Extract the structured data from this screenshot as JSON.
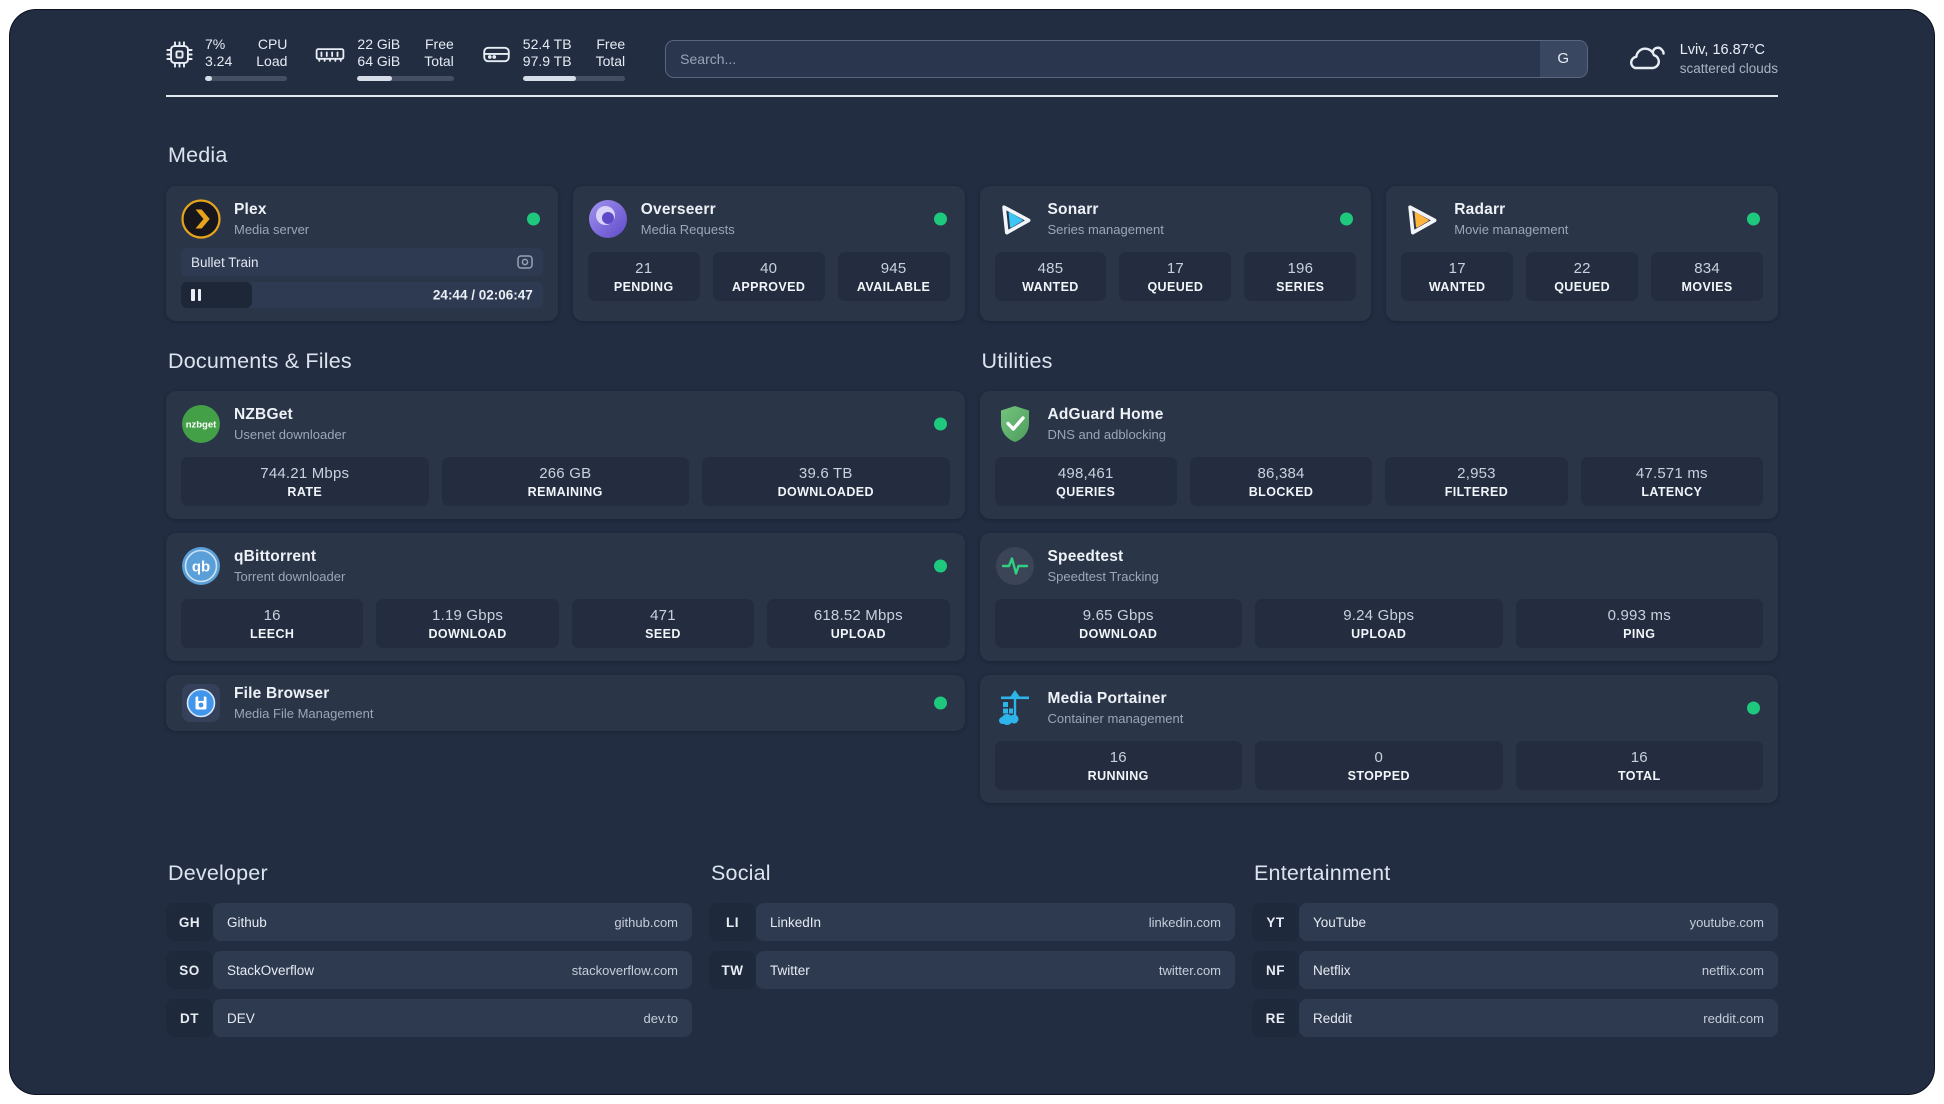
{
  "colors": {
    "status_online": "#1EC97E",
    "accent_plex": "#E6A31C",
    "accent_sonarr": "#3CC5F5",
    "accent_radarr": "#FFB53D",
    "accent_portainer": "#2DB4E9"
  },
  "header": {
    "metrics": [
      {
        "icon": "cpu-icon",
        "line1_value": "7%",
        "line2_value": "3.24",
        "line1_label": "CPU",
        "line2_label": "Load",
        "progress_pct": 8
      },
      {
        "icon": "memory-icon",
        "line1_value": "22 GiB",
        "line2_value": "64 GiB",
        "line1_label": "Free",
        "line2_label": "Total",
        "progress_pct": 36
      },
      {
        "icon": "disk-icon",
        "line1_value": "52.4 TB",
        "line2_value": "97.9 TB",
        "line1_label": "Free",
        "line2_label": "Total",
        "progress_pct": 52
      }
    ],
    "search": {
      "placeholder": "Search...",
      "engine_button": "G"
    },
    "weather": {
      "location": "Lviv, 16.87°C",
      "condition": "scattered clouds"
    }
  },
  "sections": {
    "media": {
      "title": "Media",
      "apps": [
        {
          "name": "Plex",
          "subtitle": "Media server",
          "icon": "plex-icon",
          "online": true,
          "now_playing": {
            "title": "Bullet Train",
            "time": "24:44 / 02:06:47",
            "progress_pct": 19.5
          }
        },
        {
          "name": "Overseerr",
          "subtitle": "Media Requests",
          "icon": "overseerr-icon",
          "online": true,
          "stats": [
            {
              "value": "21",
              "label": "PENDING"
            },
            {
              "value": "40",
              "label": "APPROVED"
            },
            {
              "value": "945",
              "label": "AVAILABLE"
            }
          ]
        },
        {
          "name": "Sonarr",
          "subtitle": "Series management",
          "icon": "sonarr-icon",
          "online": true,
          "stats": [
            {
              "value": "485",
              "label": "WANTED"
            },
            {
              "value": "17",
              "label": "QUEUED"
            },
            {
              "value": "196",
              "label": "SERIES"
            }
          ]
        },
        {
          "name": "Radarr",
          "subtitle": "Movie management",
          "icon": "radarr-icon",
          "online": true,
          "stats": [
            {
              "value": "17",
              "label": "WANTED"
            },
            {
              "value": "22",
              "label": "QUEUED"
            },
            {
              "value": "834",
              "label": "MOVIES"
            }
          ]
        }
      ]
    },
    "documents": {
      "title": "Documents & Files",
      "apps": [
        {
          "name": "NZBGet",
          "subtitle": "Usenet downloader",
          "icon": "nzbget-icon",
          "online": true,
          "stats": [
            {
              "value": "744.21 Mbps",
              "label": "RATE"
            },
            {
              "value": "266 GB",
              "label": "REMAINING"
            },
            {
              "value": "39.6 TB",
              "label": "DOWNLOADED"
            }
          ]
        },
        {
          "name": "qBittorrent",
          "subtitle": "Torrent downloader",
          "icon": "qbittorrent-icon",
          "online": true,
          "stats": [
            {
              "value": "16",
              "label": "LEECH"
            },
            {
              "value": "1.19 Gbps",
              "label": "DOWNLOAD"
            },
            {
              "value": "471",
              "label": "SEED"
            },
            {
              "value": "618.52 Mbps",
              "label": "UPLOAD"
            }
          ]
        },
        {
          "name": "File Browser",
          "subtitle": "Media File Management",
          "icon": "filebrowser-icon",
          "online": true
        }
      ]
    },
    "utilities": {
      "title": "Utilities",
      "apps": [
        {
          "name": "AdGuard Home",
          "subtitle": "DNS and adblocking",
          "icon": "adguard-icon",
          "online": false,
          "stats": [
            {
              "value": "498,461",
              "label": "QUERIES"
            },
            {
              "value": "86,384",
              "label": "BLOCKED"
            },
            {
              "value": "2,953",
              "label": "FILTERED"
            },
            {
              "value": "47.571 ms",
              "label": "LATENCY"
            }
          ]
        },
        {
          "name": "Speedtest",
          "subtitle": "Speedtest Tracking",
          "icon": "speedtest-icon",
          "online": false,
          "stats": [
            {
              "value": "9.65 Gbps",
              "label": "DOWNLOAD"
            },
            {
              "value": "9.24 Gbps",
              "label": "UPLOAD"
            },
            {
              "value": "0.993 ms",
              "label": "PING"
            }
          ]
        },
        {
          "name": "Media Portainer",
          "subtitle": "Container management",
          "icon": "portainer-icon",
          "online": true,
          "stats": [
            {
              "value": "16",
              "label": "RUNNING"
            },
            {
              "value": "0",
              "label": "STOPPED"
            },
            {
              "value": "16",
              "label": "TOTAL"
            }
          ]
        }
      ]
    },
    "bookmarks": [
      {
        "title": "Developer",
        "links": [
          {
            "abbr": "GH",
            "name": "Github",
            "url": "github.com"
          },
          {
            "abbr": "SO",
            "name": "StackOverflow",
            "url": "stackoverflow.com"
          },
          {
            "abbr": "DT",
            "name": "DEV",
            "url": "dev.to"
          }
        ]
      },
      {
        "title": "Social",
        "links": [
          {
            "abbr": "LI",
            "name": "LinkedIn",
            "url": "linkedin.com"
          },
          {
            "abbr": "TW",
            "name": "Twitter",
            "url": "twitter.com"
          }
        ]
      },
      {
        "title": "Entertainment",
        "links": [
          {
            "abbr": "YT",
            "name": "YouTube",
            "url": "youtube.com"
          },
          {
            "abbr": "NF",
            "name": "Netflix",
            "url": "netflix.com"
          },
          {
            "abbr": "RE",
            "name": "Reddit",
            "url": "reddit.com"
          }
        ]
      }
    ]
  }
}
